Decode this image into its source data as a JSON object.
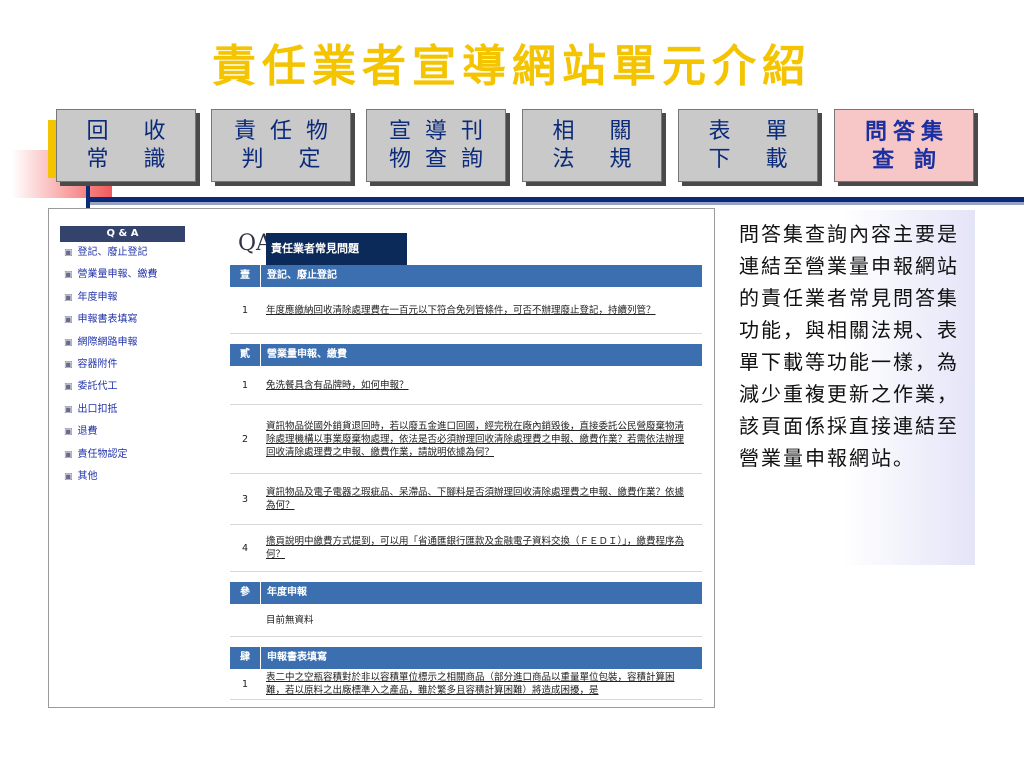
{
  "title": "責任業者宣導網站單元介紹",
  "nav": [
    {
      "line1": "回 收",
      "line2": "常 識",
      "active": false
    },
    {
      "line1": "責任物",
      "line2": "判 定",
      "active": false
    },
    {
      "line1": "宣導刊",
      "line2": "物查詢",
      "active": false
    },
    {
      "line1": "相 關",
      "line2": "法 規",
      "active": false
    },
    {
      "line1": "表 單",
      "line2": "下 載",
      "active": false
    },
    {
      "line1": "問答集",
      "line2": "查 詢",
      "active": true
    }
  ],
  "screenshot": {
    "sidebar": {
      "header": "Q & A",
      "items": [
        "登記、廢止登記",
        "營業量申報、繳費",
        "年度申報",
        "申報書表填寫",
        "網際網路申報",
        "容器附件",
        "委託代工",
        "出口扣抵",
        "退費",
        "責任物認定",
        "其他"
      ]
    },
    "main": {
      "logo": "QA",
      "heading": "責任業者常見問題",
      "sections": [
        {
          "num": "壹",
          "label": "登記、廢止登記",
          "questions": [
            {
              "num": "1",
              "text": "年度應繳納回收清除處理費在一百元以下符合免列管條件，可否不辦理廢止登記，持續列管？"
            }
          ]
        },
        {
          "num": "貳",
          "label": "營業量申報、繳費",
          "questions": [
            {
              "num": "1",
              "text": "免洗餐具含有品牌時，如何申報？"
            },
            {
              "num": "2",
              "text": "資訊物品從國外銷貨退回時，若以廢五金進口回國，經完稅在廠內銷毀後，直接委託公民營廢棄物清除處理機構以事業廢棄物處理，依法是否必須辦理回收清除處理費之申報、繳費作業？若需依法辦理回收清除處理費之申報、繳費作業，請說明依據為何？"
            },
            {
              "num": "3",
              "text": "資訊物品及電子電器之瑕疵品、呆滯品、下腳料是否須辦理回收清除處理費之申報、繳費作業？依據為何？"
            },
            {
              "num": "4",
              "text": "擔頁說明中繳費方式提到，可以用「省通匯銀行匯款及金融電子資料交換（ＦＥＤＩ）」，繳費程序為何？"
            }
          ]
        },
        {
          "num": "參",
          "label": "年度申報",
          "questions": [
            {
              "num": "",
              "text": "目前無資料"
            }
          ]
        },
        {
          "num": "肆",
          "label": "申報書表填寫",
          "questions": [
            {
              "num": "1",
              "text": "表二中之空瓶容積對於非以容積單位標示之相關商品（部分進口商品以重量單位包裝，容積計算困難，若以原料之出廠標準入之產品，雖於繁多且容積計算困難）將造成困擾，是"
            }
          ]
        }
      ]
    }
  },
  "description": "問答集查詢內容主要是連結至營業量申報網站的責任業者常見問答集功能，與相關法規、表單下載等功能一樣，為減少重複更新之作業，該頁面係採直接連結至營業量申報網站。"
}
